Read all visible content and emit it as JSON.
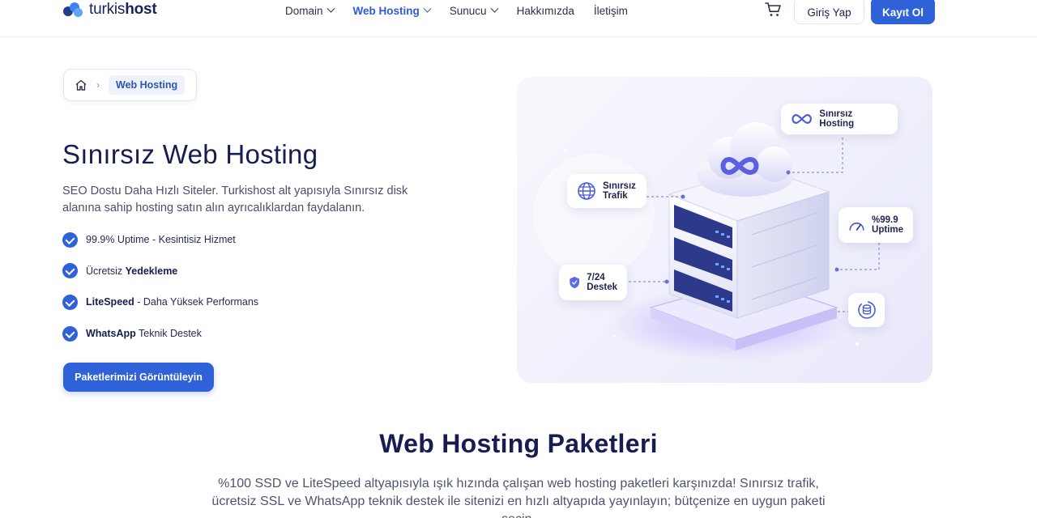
{
  "header": {
    "logo": {
      "light": "turkis",
      "bold": "host"
    },
    "nav": [
      {
        "label": "Domain",
        "has_dropdown": true,
        "active": false
      },
      {
        "label": "Web Hosting",
        "has_dropdown": true,
        "active": true
      },
      {
        "label": "Sunucu",
        "has_dropdown": true,
        "active": false
      },
      {
        "label": "Hakkımızda",
        "has_dropdown": false,
        "active": false
      },
      {
        "label": "İletişim",
        "has_dropdown": false,
        "active": false
      }
    ],
    "cart_icon": "cart-icon",
    "login_label": "Giriş Yap",
    "register_label": "Kayıt Ol"
  },
  "breadcrumb": {
    "home_icon": "home-icon",
    "separator": "›",
    "current": "Web Hosting"
  },
  "hero": {
    "title": "Sınırsız Web Hosting",
    "description": "SEO Dostu Daha Hızlı Siteler. Turkishost alt yapısıyla Sınırsız disk alanına sahip hosting satın alın ayrıcalıklardan faydalanın.",
    "features": [
      {
        "pre": "",
        "bold": "",
        "post": "99.9% Uptime - Kesintisiz Hizmet"
      },
      {
        "pre": "Ücretsiz ",
        "bold": "Yedekleme",
        "post": ""
      },
      {
        "pre": "",
        "bold": "LiteSpeed",
        "post": " - Daha Yüksek Performans"
      },
      {
        "pre": "",
        "bold": "WhatsApp",
        "post": " Teknik Destek"
      }
    ],
    "cta_label": "Paketlerimizi Görüntüleyin"
  },
  "illustration": {
    "chips": {
      "unlimited_hosting": "Sınırsız Hosting",
      "traffic_line1": "Sınırsız",
      "traffic_line2": "Trafik",
      "uptime_line1": "%99.9",
      "uptime_line2": "Uptime",
      "support_line1": "7/24",
      "support_line2": "Destek"
    },
    "colors": {
      "accent": "#2f62d8",
      "purple": "#7b6cf0",
      "background": "#eeeffb"
    }
  },
  "packages_section": {
    "title": "Web Hosting Paketleri",
    "description": "%100 SSD ve LiteSpeed altyapısıyla ışık hızında çalışan web hosting paketleri karşınızda! Sınırsız trafik, ücretsiz SSL ve WhatsApp teknik destek ile sitenizi en hızlı altyapıda yayınlayın; bütçenize en uygun paketi seçin."
  }
}
